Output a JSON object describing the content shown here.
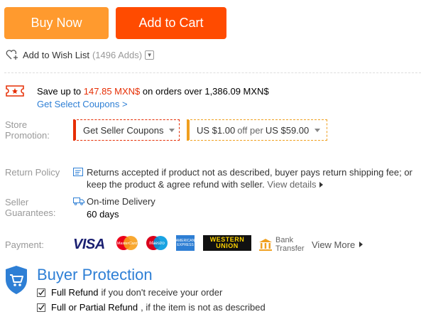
{
  "actions": {
    "buy_now": "Buy Now",
    "add_to_cart": "Add to Cart"
  },
  "wishlist": {
    "label": "Add to Wish List",
    "count": "(1496 Adds)"
  },
  "coupon": {
    "prefix": "Save up to",
    "amount": "147.85 MXN$",
    "suffix": "on orders over 1,386.09 MXN$",
    "link": "Get Select Coupons >"
  },
  "store_promotion": {
    "label_line1": "Store",
    "label_line2": "Promotion:",
    "seller_coupons": "Get Seller Coupons",
    "promo_a": "US $1.00",
    "promo_off": "off per",
    "promo_b": "US $59.00"
  },
  "return_policy": {
    "label": "Return Policy",
    "text": "Returns accepted if product not as described, buyer pays return shipping fee; or keep the product & agree refund with seller.",
    "link": "View details"
  },
  "seller_guarantees": {
    "label_line1": "Seller",
    "label_line2": "Guarantees:",
    "delivery": "On-time Delivery",
    "days": "60 days"
  },
  "payment": {
    "label": "Payment:",
    "visa": "VISA",
    "mastercard": "MasterCard",
    "maestro": "Maestro",
    "amex": "AMERICAN EXPRESS",
    "wu_line1": "WESTERN",
    "wu_line2": "UNION",
    "bank_line1": "Bank",
    "bank_line2": "Transfer",
    "view_more": "View More"
  },
  "buyer_protection": {
    "title": "Buyer Protection",
    "items": [
      {
        "bold": "Full Refund",
        "rest": "if you don't receive your order"
      },
      {
        "bold": "Full or Partial Refund",
        "rest": ", if the item is not as described"
      }
    ]
  },
  "colors": {
    "buy_now": "#ff9a2e",
    "add_to_cart": "#ff4b00",
    "price_red": "#e62e04",
    "link_blue": "#2e7fd5"
  }
}
